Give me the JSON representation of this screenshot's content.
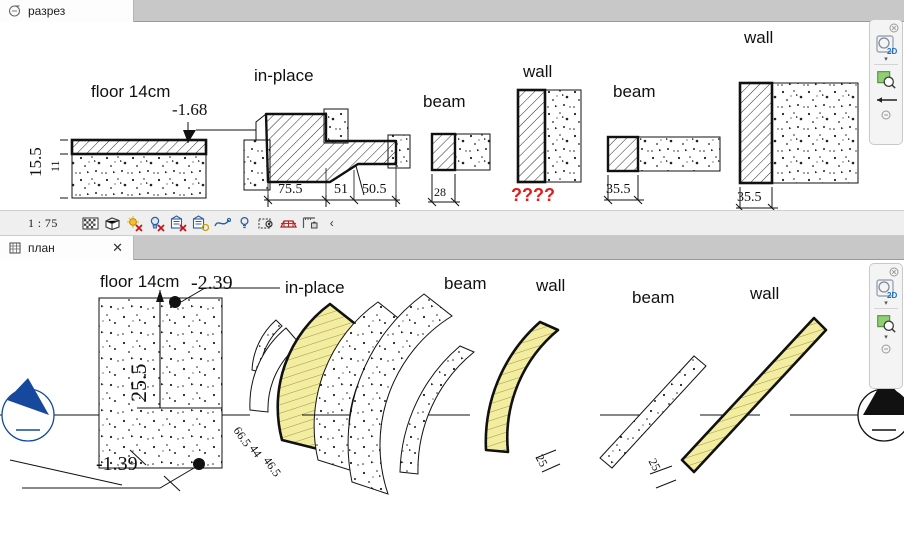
{
  "window": {
    "tabs": [
      {
        "label": "разрез",
        "icon": "section-marker-icon",
        "closable": false
      },
      {
        "label": "план",
        "icon": "plan-grid-icon",
        "closable": true,
        "close_label": "✕"
      }
    ]
  },
  "statusbar": {
    "scale": "1 : 75",
    "icons": [
      "transparency-icon",
      "3d-box-icon",
      "sun-off-icon",
      "light-off-icon",
      "render-off-icon",
      "render-settings-icon",
      "spline-icon",
      "bulb-icon",
      "camera-icon",
      "perspective-off-icon",
      "measure-lock-icon"
    ],
    "overflow_caret": "‹",
    "scroll_arrow": "❯"
  },
  "nav_palette": {
    "close_label": "⊗",
    "mode_label": "2D",
    "buttons": [
      "orbit-2d-icon",
      "zoom-window-icon"
    ],
    "caret": "▾",
    "collapse_label": "⊖",
    "back_arrow": "back-arrow-icon"
  },
  "section_view": {
    "name": "разрез",
    "items": [
      {
        "name": "floor-detail",
        "title": "floor 14cm",
        "elevation": "-1.68",
        "dim_total": "15.5",
        "dim_slab": "11"
      },
      {
        "name": "in-place-detail",
        "title": "in-place",
        "dims": [
          "75.5",
          "51",
          "50.5"
        ]
      },
      {
        "name": "beam-detail-1",
        "title": "beam",
        "dims": [
          "28"
        ]
      },
      {
        "name": "wall-detail-1",
        "title": "wall",
        "dims": [
          "????"
        ],
        "dim_color": "#e01b1b"
      },
      {
        "name": "beam-detail-2",
        "title": "beam",
        "dims": [
          "35.5"
        ]
      },
      {
        "name": "wall-detail-2",
        "title": "wall",
        "dims": [
          "35.5"
        ]
      }
    ]
  },
  "plan_view": {
    "name": "план",
    "items": [
      {
        "name": "floor-plan",
        "title": "floor 14cm",
        "elevation_top": "-2.39",
        "elevation_bottom": "-1.39",
        "dim_height": "25.5"
      },
      {
        "name": "in-place-plan",
        "title": "in-place",
        "dims": [
          "66.5",
          "44",
          "46.5"
        ]
      },
      {
        "name": "beam-plan-curved",
        "title": "beam"
      },
      {
        "name": "wall-plan-curved",
        "title": "wall",
        "dims": [
          "25"
        ],
        "fill": "#f2eda0"
      },
      {
        "name": "beam-plan-straight",
        "title": "beam"
      },
      {
        "name": "wall-plan-straight",
        "title": "wall",
        "dims": [
          "25"
        ],
        "fill": "#f2eda0"
      }
    ],
    "section_markers": [
      "section-marker-left",
      "section-marker-right"
    ]
  },
  "colors": {
    "highlight_fill": "#f2eda0",
    "alert_text": "#e01b1b",
    "marker_blue": "#16499d",
    "tab_active": "#fdfdfd",
    "tabbar_bg": "#c8c8c8"
  }
}
